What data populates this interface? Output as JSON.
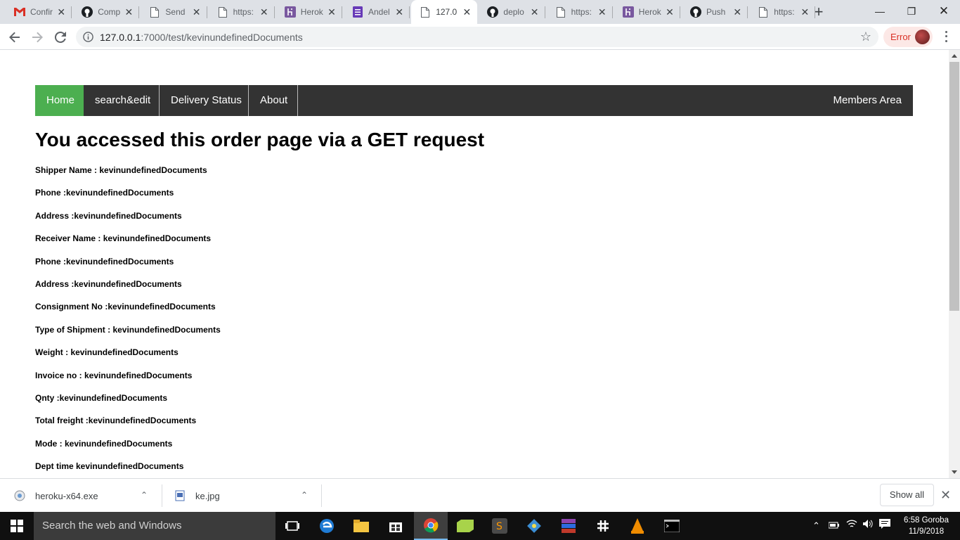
{
  "browser": {
    "tabs": [
      {
        "title": "Confir",
        "icon": "gmail-icon"
      },
      {
        "title": "Comp",
        "icon": "github-icon"
      },
      {
        "title": "Send",
        "icon": "page-icon"
      },
      {
        "title": "https:",
        "icon": "page-icon"
      },
      {
        "title": "Herok",
        "icon": "heroku-icon"
      },
      {
        "title": "Andel",
        "icon": "forms-icon"
      },
      {
        "title": "127.0",
        "icon": "page-icon",
        "active": true
      },
      {
        "title": "deplo",
        "icon": "github-icon"
      },
      {
        "title": "https:",
        "icon": "page-icon"
      },
      {
        "title": "Herok",
        "icon": "heroku-icon"
      },
      {
        "title": "Push",
        "icon": "github-icon"
      },
      {
        "title": "https:",
        "icon": "page-icon"
      }
    ],
    "url_host": "127.0.0.1",
    "url_path": ":7000/test/kevinundefinedDocuments",
    "profile_status": "Error"
  },
  "page": {
    "nav": {
      "items": [
        "Home",
        "search&edit",
        "Delivery Status",
        "About"
      ],
      "right": "Members Area"
    },
    "heading": "You accessed this order page via a GET request",
    "fields": [
      "Shipper Name : kevinundefinedDocuments",
      "Phone :kevinundefinedDocuments",
      "Address :kevinundefinedDocuments",
      "Receiver Name : kevinundefinedDocuments",
      "Phone :kevinundefinedDocuments",
      "Address :kevinundefinedDocuments",
      "Consignment No :kevinundefinedDocuments",
      "Type of Shipment : kevinundefinedDocuments",
      "Weight : kevinundefinedDocuments",
      "Invoice no : kevinundefinedDocuments",
      "Qnty :kevinundefinedDocuments",
      "Total freight :kevinundefinedDocuments",
      "Mode : kevinundefinedDocuments",
      "Dept time kevinundefinedDocuments"
    ]
  },
  "downloads": {
    "items": [
      "heroku-x64.exe",
      "ke.jpg"
    ],
    "show_all": "Show all"
  },
  "taskbar": {
    "search_placeholder": "Search the web and Windows",
    "time": "6:58 Goroba",
    "date": "11/9/2018"
  },
  "colors": {
    "nav_bg": "#333333",
    "nav_active": "#4caf50",
    "error_text": "#d93025"
  }
}
